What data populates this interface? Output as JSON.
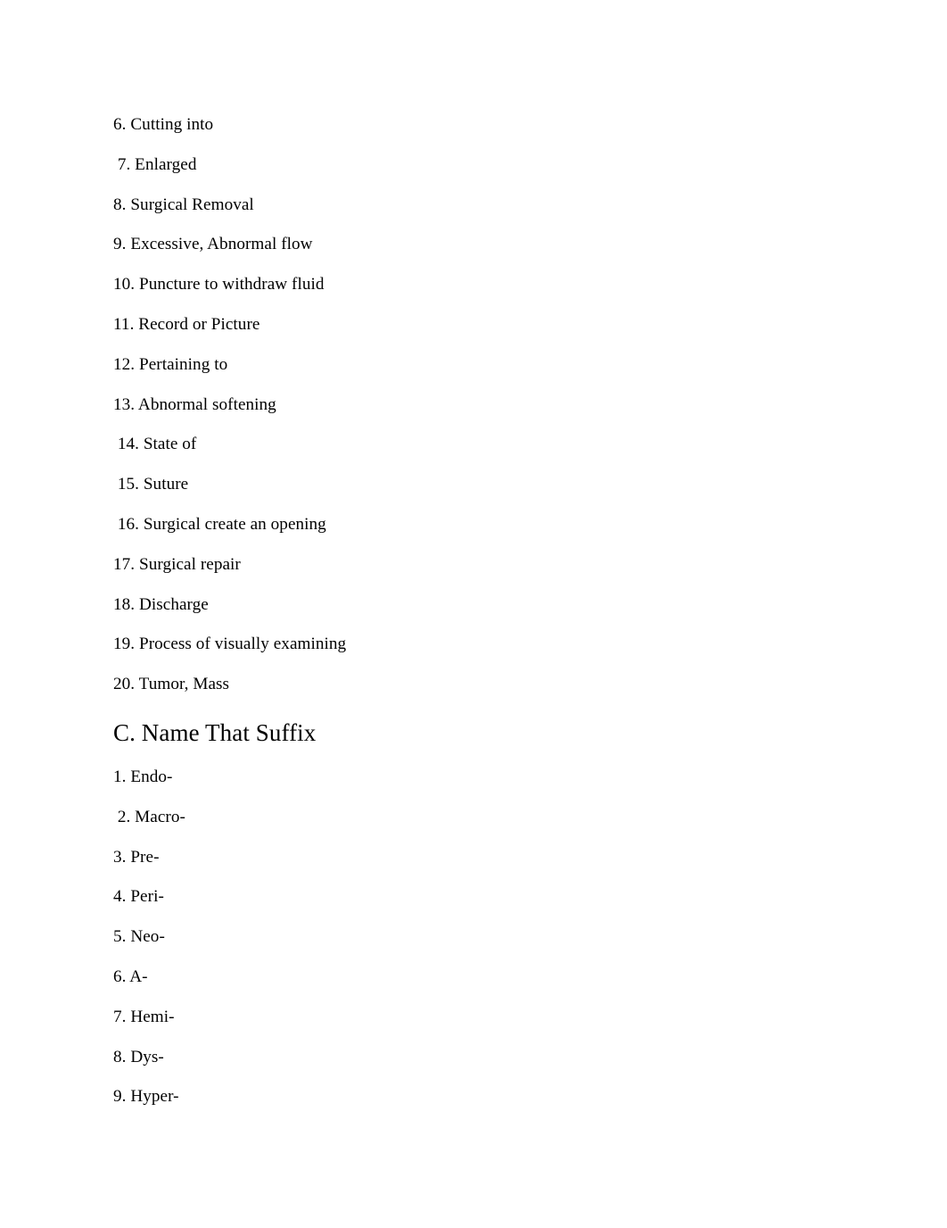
{
  "document": {
    "background_color": "#ffffff",
    "text_color": "#010101",
    "blocks": [
      {
        "kind": "line",
        "text": "6. Cutting into"
      },
      {
        "kind": "line",
        "text": " 7. Enlarged"
      },
      {
        "kind": "line",
        "text": "8. Surgical Removal"
      },
      {
        "kind": "line",
        "text": "9. Excessive, Abnormal flow"
      },
      {
        "kind": "line",
        "text": "10. Puncture to withdraw fluid"
      },
      {
        "kind": "line",
        "text": "11. Record or Picture"
      },
      {
        "kind": "line",
        "text": "12. Pertaining to"
      },
      {
        "kind": "line",
        "text": "13. Abnormal softening"
      },
      {
        "kind": "line",
        "text": " 14. State of"
      },
      {
        "kind": "line",
        "text": " 15. Suture"
      },
      {
        "kind": "line",
        "text": " 16. Surgical create an opening"
      },
      {
        "kind": "line",
        "text": "17. Surgical repair"
      },
      {
        "kind": "line",
        "text": "18. Discharge"
      },
      {
        "kind": "line",
        "text": "19. Process of visually examining"
      },
      {
        "kind": "line",
        "text": "20. Tumor, Mass"
      },
      {
        "kind": "heading",
        "text": "C. Name That Suffix"
      },
      {
        "kind": "line",
        "text": "1. Endo-"
      },
      {
        "kind": "line",
        "text": " 2. Macro-"
      },
      {
        "kind": "line",
        "text": "3. Pre-"
      },
      {
        "kind": "line",
        "text": "4. Peri-"
      },
      {
        "kind": "line",
        "text": "5. Neo-"
      },
      {
        "kind": "line",
        "text": "6. A-"
      },
      {
        "kind": "line",
        "text": "7. Hemi-"
      },
      {
        "kind": "line",
        "text": "8. Dys-"
      },
      {
        "kind": "line",
        "text": "9. Hyper-"
      }
    ]
  }
}
